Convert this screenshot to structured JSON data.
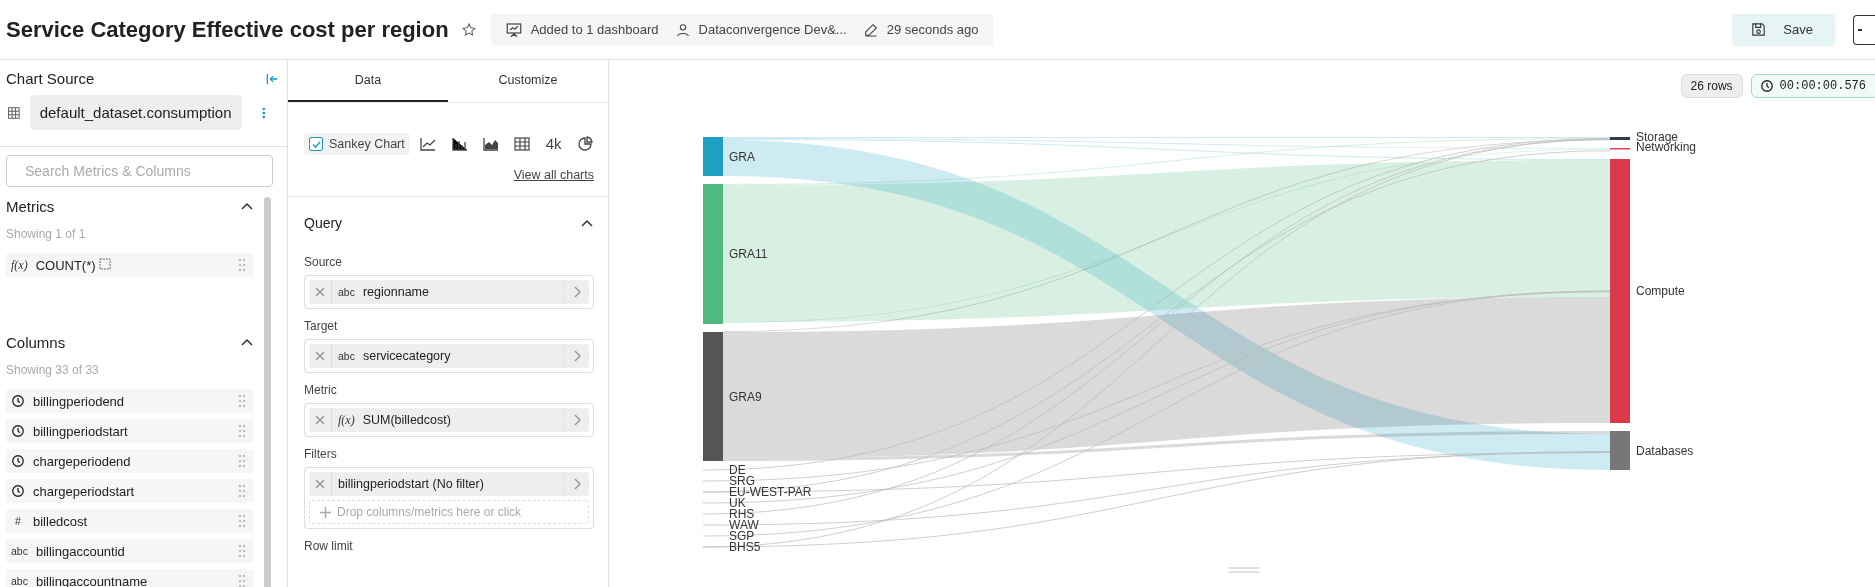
{
  "header": {
    "title": "Service Category Effective cost per region",
    "meta": [
      {
        "kind": "dashboard",
        "text": "Added to 1 dashboard"
      },
      {
        "kind": "owner",
        "text": "Dataconvergence Dev&..."
      },
      {
        "kind": "modified",
        "text": "29 seconds ago"
      }
    ],
    "save_label": "Save"
  },
  "chart_source": {
    "title": "Chart Source",
    "dataset": "default_dataset.consumption",
    "search": {
      "placeholder": "Search Metrics & Columns"
    }
  },
  "metrics": {
    "title": "Metrics",
    "count": "Showing 1 of 1",
    "items": [
      {
        "kind": "metric",
        "type_label": "f(x)",
        "label": "COUNT(*)"
      }
    ]
  },
  "columns": {
    "title": "Columns",
    "count": "Showing 33 of 33",
    "items": [
      {
        "kind": "time",
        "label": "billingperiodend"
      },
      {
        "kind": "time",
        "label": "billingperiodstart"
      },
      {
        "kind": "time",
        "label": "chargeperiodend"
      },
      {
        "kind": "time",
        "label": "chargeperiodstart"
      },
      {
        "kind": "number",
        "type_label": "#",
        "label": "billedcost"
      },
      {
        "kind": "string",
        "type_label": "abc",
        "label": "billingaccountid"
      },
      {
        "kind": "string",
        "type_label": "abc",
        "label": "billingaccountname"
      }
    ]
  },
  "tabs": [
    {
      "label": "Data",
      "selected": true
    },
    {
      "label": "Customize",
      "selected": false
    }
  ],
  "chart_types": [
    {
      "kind": "sankey",
      "label": "Sankey Chart",
      "selected": true
    },
    {
      "kind": "line",
      "selected": false
    },
    {
      "kind": "bar",
      "selected": false
    },
    {
      "kind": "area",
      "selected": false
    },
    {
      "kind": "table",
      "selected": false
    },
    {
      "kind": "big-number",
      "label": "4k",
      "selected": false
    },
    {
      "kind": "pie",
      "selected": false
    }
  ],
  "view_all_link": "View all charts",
  "query": {
    "title": "Query",
    "sections": [
      {
        "label": "Source",
        "items": [
          {
            "kind": "string",
            "type_label": "abc",
            "value": "regionname"
          }
        ]
      },
      {
        "label": "Target",
        "items": [
          {
            "kind": "string",
            "type_label": "abc",
            "value": "servicecategory"
          }
        ]
      },
      {
        "label": "Metric",
        "items": [
          {
            "kind": "metric",
            "type_label": "f(x)",
            "value": "SUM(billedcost)"
          }
        ]
      },
      {
        "label": "Filters",
        "items": [
          {
            "kind": "filter",
            "value": "billingperiodstart (No filter)"
          }
        ],
        "drop_hint": "Drop columns/metrics here or click"
      },
      {
        "label": "Row limit"
      }
    ]
  },
  "results": {
    "rows": "26 rows",
    "duration": "00:00:00.576"
  },
  "sankey": {
    "sources": [
      {
        "label": "GRA",
        "color": "#1fa0c3"
      },
      {
        "label": "GRA11",
        "color": "#4fb97e"
      },
      {
        "label": "GRA9",
        "color": "#555555"
      },
      {
        "label": "DE"
      },
      {
        "label": "SRG"
      },
      {
        "label": "EU-WEST-PAR"
      },
      {
        "label": "UK"
      },
      {
        "label": "RHS"
      },
      {
        "label": "WAW"
      },
      {
        "label": "SGP"
      },
      {
        "label": "BHS5"
      }
    ],
    "targets": [
      {
        "label": "Storage",
        "color": "#333d47"
      },
      {
        "label": "Networking",
        "color": "#e04355"
      },
      {
        "label": "Compute",
        "color": "#dc3a4a"
      },
      {
        "label": "Databases",
        "color": "#777777"
      }
    ]
  }
}
